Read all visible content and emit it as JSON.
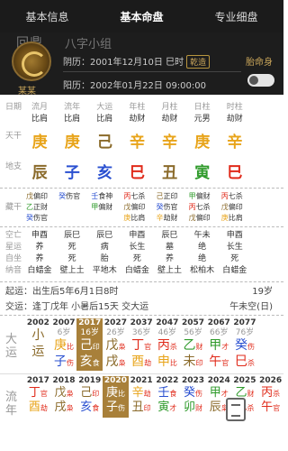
{
  "tabs": [
    "基本信息",
    "基本命盘",
    "专业细盘"
  ],
  "header": {
    "watermark": "八字小组",
    "wlogo": "回鼎",
    "name": "某某",
    "yinli_label": "阴历：",
    "yinli": "2001年12月10日 巳时",
    "yinli_badge": "乾造",
    "yangli_label": "阳历：",
    "yangli": "2002年01月22日 09:00:00",
    "taiming": "胎命身"
  },
  "pillars": {
    "row_date": [
      "日期",
      "流月",
      "流年",
      "大运",
      "年柱",
      "月柱",
      "日柱",
      "时柱"
    ],
    "row_shishen": [
      "比肩",
      "比肩",
      "比肩",
      "劫财",
      "劫财",
      "元男",
      "劫财"
    ],
    "tiangan_label": "天干",
    "tiangan": [
      "庚",
      "庚",
      "己",
      "辛",
      "辛",
      "庚",
      "辛"
    ],
    "dizhi_label": "地支",
    "dizhi": [
      "辰",
      "子",
      "亥",
      "巳",
      "丑",
      "寅",
      "巳"
    ],
    "canggan_label": "藏干",
    "canggan": [
      [
        [
          "戊",
          "偏印"
        ],
        [
          "乙",
          "正财"
        ],
        [
          "癸",
          "伤官"
        ]
      ],
      [
        [
          "癸",
          "伤官"
        ]
      ],
      [
        [
          "壬",
          "食神"
        ],
        [
          "甲",
          "偏财"
        ]
      ],
      [
        [
          "丙",
          "七杀"
        ],
        [
          "戊",
          "偏印"
        ],
        [
          "庚",
          "比肩"
        ]
      ],
      [
        [
          "己",
          "正印"
        ],
        [
          "癸",
          "伤官"
        ],
        [
          "辛",
          "劫财"
        ]
      ],
      [
        [
          "甲",
          "偏财"
        ],
        [
          "丙",
          "七杀"
        ],
        [
          "戊",
          "偏印"
        ]
      ],
      [
        [
          "丙",
          "七杀"
        ],
        [
          "戊",
          "偏印"
        ],
        [
          "庚",
          "比肩"
        ]
      ]
    ],
    "kongwang_label": "空亡\n星运\n自坐\n纳音",
    "kongwang": [
      [
        "申酉",
        "养",
        "养",
        "白蜡金"
      ],
      [
        "辰巳",
        "死",
        "死",
        "壁上土"
      ],
      [
        "辰巳",
        "病",
        "胎",
        "平地木"
      ],
      [
        "申酉",
        "长生",
        "死",
        "白蜡金"
      ],
      [
        "辰巳",
        "墓",
        "养",
        "壁上土"
      ],
      [
        "午未",
        "绝",
        "绝",
        "松柏木"
      ],
      [
        "申酉",
        "长生",
        "死",
        "白蜡金"
      ]
    ]
  },
  "info": {
    "qiyun": "起运：出生后5年6月1日8时",
    "qiyun_r": "19岁",
    "jiaoyun": "交运：逢丁戊年 小暑后15天 交大运",
    "jiaoyun_r": "午未空(日)"
  },
  "dayun": {
    "label": "大运",
    "ages": [
      "2002",
      "2007",
      "2017",
      "2027",
      "2037",
      "2047",
      "2057",
      "2067",
      "2077"
    ],
    "sub": [
      "",
      "6岁",
      "16岁",
      "26岁",
      "36岁",
      "46岁",
      "56岁",
      "66岁",
      "76岁"
    ],
    "gan": [
      "小",
      "庚",
      "己",
      "戊",
      "丁",
      "丙",
      "乙",
      "甲",
      "癸"
    ],
    "gs": [
      "",
      "比",
      "印",
      "枭",
      "官",
      "杀",
      "财",
      "才",
      "伤"
    ],
    "zhi": [
      "运",
      "子",
      "亥",
      "戌",
      "酉",
      "申",
      "未",
      "午",
      "巳"
    ],
    "zs": [
      "",
      "伤",
      "食",
      "枭",
      "劫",
      "比",
      "印",
      "官",
      "杀"
    ]
  },
  "liunian": {
    "label": "流年",
    "years": [
      "2017",
      "2018",
      "2019",
      "2020",
      "2021",
      "2022",
      "2023",
      "2024",
      "2025",
      "2026"
    ],
    "gan": [
      "丁",
      "戊",
      "己",
      "庚",
      "辛",
      "壬",
      "癸",
      "甲",
      "乙",
      "丙"
    ],
    "gs": [
      "官",
      "枭",
      "印",
      "比",
      "劫",
      "食",
      "伤",
      "才",
      "财",
      "杀"
    ],
    "zhi": [
      "酉",
      "戌",
      "亥",
      "子",
      "丑",
      "寅",
      "卯",
      "辰",
      "巳",
      "午"
    ],
    "zs": [
      "劫",
      "枭",
      "食",
      "伤",
      "印",
      "才",
      "财",
      "枭",
      "杀",
      "官"
    ],
    "age": "小运"
  }
}
